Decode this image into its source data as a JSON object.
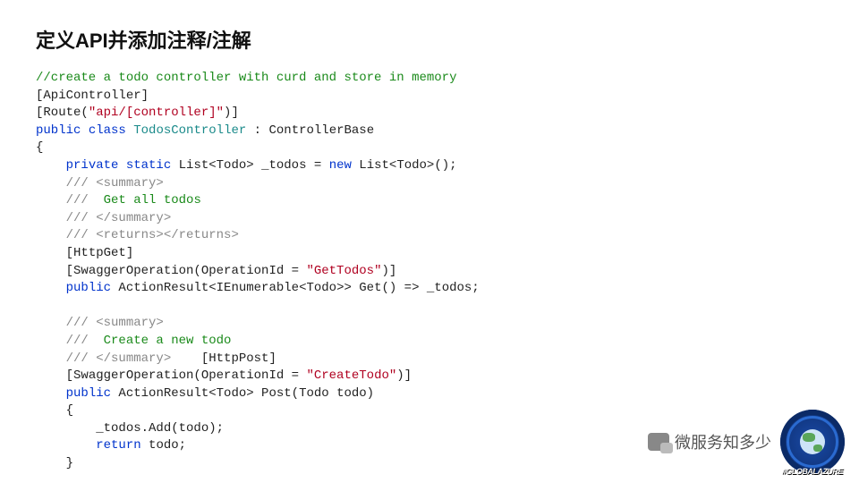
{
  "slide": {
    "title": "定义API并添加注释/注解"
  },
  "code": {
    "l01": "//create a todo controller with curd and store in memory",
    "l02a": "[ApiController]",
    "l03a": "[Route(",
    "l03b": "\"api/[controller]\"",
    "l03c": ")]",
    "l04a": "public",
    "l04b": "class",
    "l04c": "TodosController",
    "l04d": " : ControllerBase",
    "l05": "{",
    "l06a": "private",
    "l06b": "static",
    "l06c": " List<Todo> _todos = ",
    "l06d": "new",
    "l06e": " List<Todo>();",
    "l07": "/// <summary>",
    "l08a": "///  ",
    "l08b": "Get all todos",
    "l09": "/// </summary>",
    "l10": "/// <returns></returns>",
    "l11": "[HttpGet]",
    "l12a": "[SwaggerOperation(OperationId = ",
    "l12b": "\"GetTodos\"",
    "l12c": ")]",
    "l13a": "public",
    "l13b": " ActionResult<IEnumerable<Todo>> Get() => _todos;",
    "l14": "",
    "l15": "/// <summary>",
    "l16a": "///  ",
    "l16b": "Create a new todo",
    "l17a": "/// </summary>",
    "l17b": "    [HttpPost]",
    "l18a": "[SwaggerOperation(OperationId = ",
    "l18b": "\"CreateTodo\"",
    "l18c": ")]",
    "l19a": "public",
    "l19b": " ActionResult<Todo> Post(Todo todo)",
    "l20": "{",
    "l21": "_todos.Add(todo);",
    "l22a": "return",
    "l22b": " todo;",
    "l23": "}"
  },
  "footer": {
    "wechat_text": "微服务知多少",
    "logo_text": "#GLOBALAZURE"
  }
}
